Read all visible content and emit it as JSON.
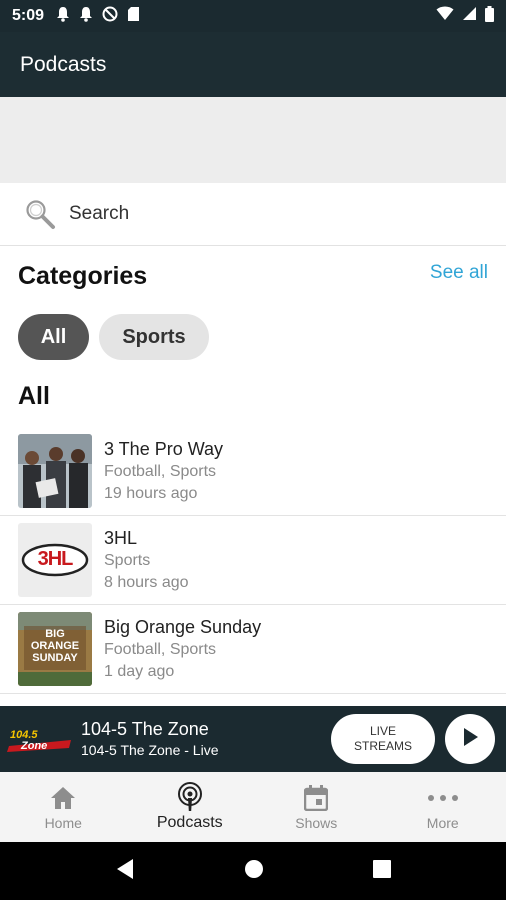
{
  "status_bar": {
    "time": "5:09",
    "left_icons": [
      "bell-icon",
      "bell-icon",
      "do-not-disturb-icon",
      "sd-card-icon"
    ],
    "right_icons": [
      "wifi-icon",
      "signal-icon",
      "battery-icon"
    ]
  },
  "app_bar": {
    "title": "Podcasts"
  },
  "search": {
    "label": "Search",
    "icon": "search-icon"
  },
  "categories": {
    "title": "Categories",
    "see_all": "See all",
    "chips": [
      {
        "label": "All",
        "selected": true
      },
      {
        "label": "Sports",
        "selected": false
      }
    ]
  },
  "all_section": {
    "title": "All",
    "items": [
      {
        "title": "3 The Pro Way",
        "categories": "Football, Sports",
        "updated": "19 hours ago"
      },
      {
        "title": "3HL",
        "categories": "Sports",
        "updated": "8 hours ago",
        "thumb_text": "3HL"
      },
      {
        "title": "Big Orange Sunday",
        "categories": "Football, Sports",
        "updated": "1 day ago",
        "thumb_text": "BIG ORANGE SUNDAY"
      }
    ]
  },
  "now_playing": {
    "logo_text": "104.5 The Zone",
    "station": "104-5 The Zone",
    "status": "104-5 The Zone - Live",
    "live_streams_line1": "LIVE",
    "live_streams_line2": "STREAMS"
  },
  "bottom_nav": {
    "items": [
      {
        "label": "Home",
        "icon": "home-icon",
        "active": false
      },
      {
        "label": "Podcasts",
        "icon": "podcast-icon",
        "active": true
      },
      {
        "label": "Shows",
        "icon": "calendar-icon",
        "active": false
      },
      {
        "label": "More",
        "icon": "more-icon",
        "active": false
      }
    ]
  },
  "colors": {
    "app_bar": "#1d2d33",
    "accent_link": "#31a5d6",
    "chip_selected": "#555555",
    "logo_accent": "#f4c400"
  }
}
